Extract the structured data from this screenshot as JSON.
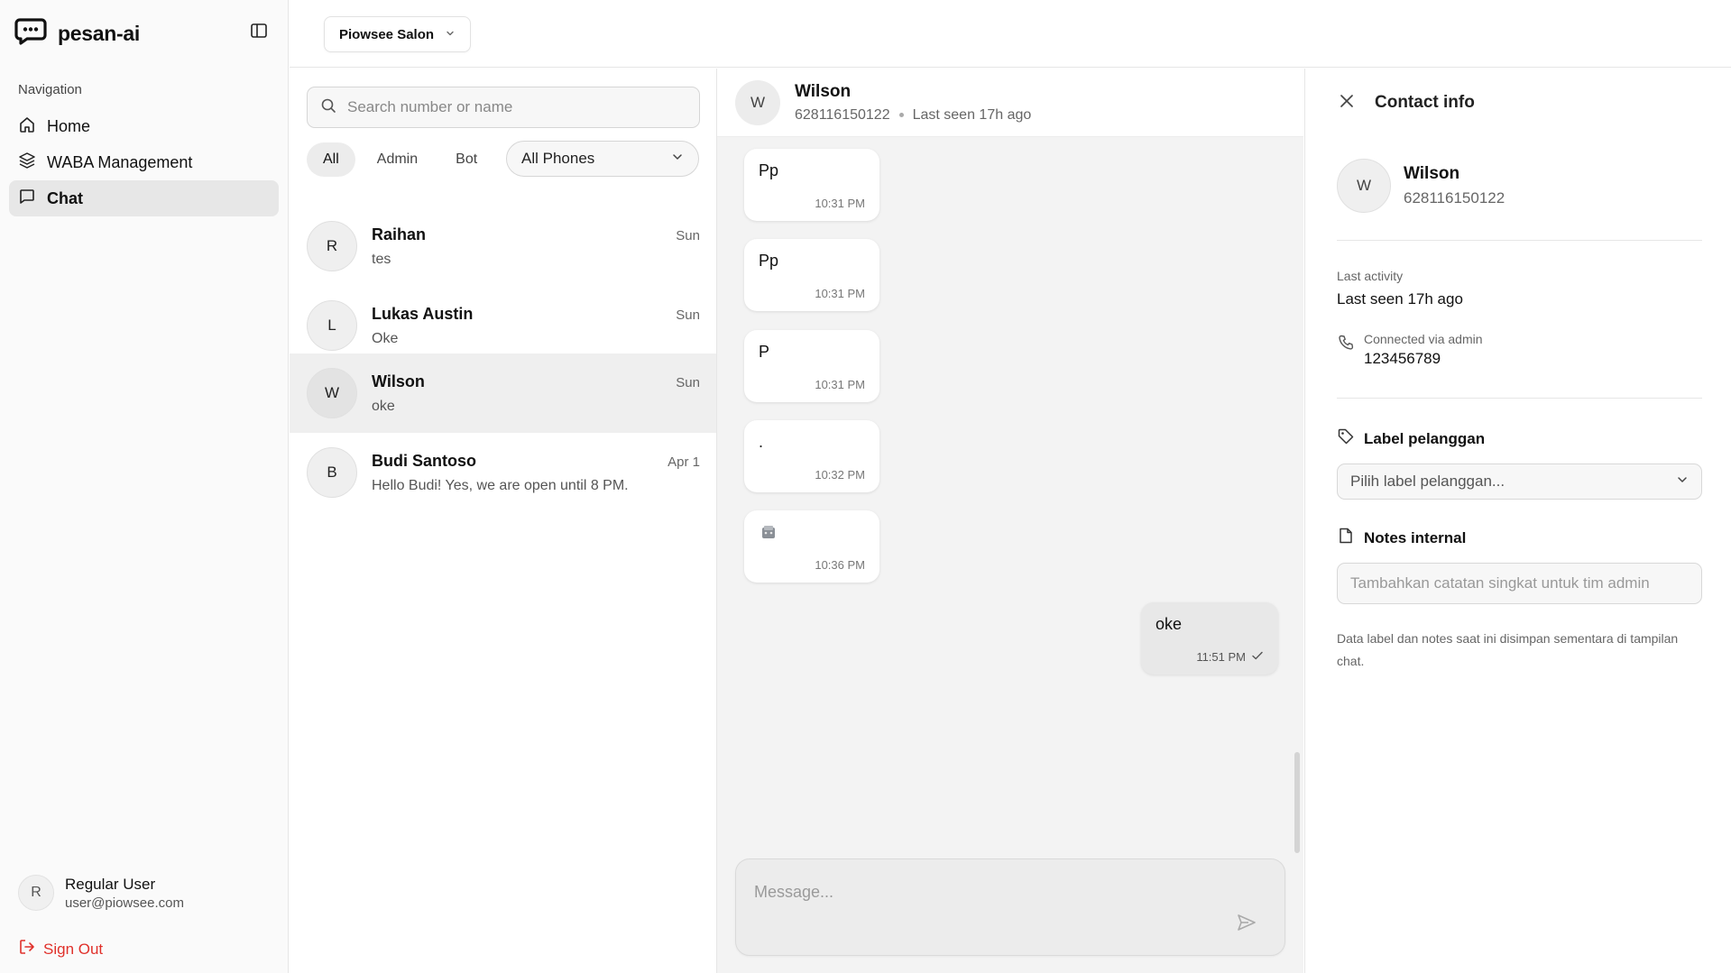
{
  "app": {
    "name": "pesan-ai"
  },
  "sidebar": {
    "nav_heading": "Navigation",
    "items": [
      {
        "label": "Home",
        "icon": "home-icon"
      },
      {
        "label": "WABA Management",
        "icon": "layers-icon"
      },
      {
        "label": "Chat",
        "icon": "message-square-icon",
        "active": true
      }
    ],
    "user": {
      "initial": "R",
      "name": "Regular User",
      "email": "user@piowsee.com"
    },
    "sign_out": "Sign Out"
  },
  "topbar": {
    "workspace": "Piowsee Salon"
  },
  "list": {
    "search_placeholder": "Search number or name",
    "filters": [
      "All",
      "Admin",
      "Bot"
    ],
    "active_filter": "All",
    "phone_filter": "All Phones",
    "conversations": [
      {
        "initial": "R",
        "name": "Raihan",
        "time": "Sun",
        "preview": "tes"
      },
      {
        "initial": "L",
        "name": "Lukas Austin",
        "time": "Sun",
        "preview": "Oke"
      },
      {
        "initial": "W",
        "name": "Wilson",
        "time": "Sun",
        "preview": "oke",
        "active": true
      },
      {
        "initial": "B",
        "name": "Budi Santoso",
        "time": "Apr 1",
        "preview": "Hello Budi! Yes, we are open until 8 PM."
      }
    ]
  },
  "chat": {
    "initial": "W",
    "name": "Wilson",
    "phone": "628116150122",
    "status": "Last seen 17h ago",
    "messages": [
      {
        "direction": "in",
        "text": "Pp",
        "time": "10:31 PM"
      },
      {
        "direction": "in",
        "text": "Pp",
        "time": "10:31 PM"
      },
      {
        "direction": "in",
        "text": "P",
        "time": "10:31 PM"
      },
      {
        "direction": "in",
        "text": ".",
        "time": "10:32 PM"
      },
      {
        "direction": "in",
        "text": "",
        "time": "10:36 PM",
        "attachment": "sticker-icon"
      },
      {
        "direction": "out",
        "text": "oke",
        "time": "11:51 PM",
        "status": "sent"
      }
    ],
    "composer_placeholder": "Message..."
  },
  "contact_info": {
    "title": "Contact info",
    "initial": "W",
    "name": "Wilson",
    "phone": "628116150122",
    "last_activity_label": "Last activity",
    "last_activity_value": "Last seen 17h ago",
    "connected_label": "Connected via admin",
    "connected_value": "123456789",
    "label_section": "Label pelanggan",
    "label_placeholder": "Pilih label pelanggan...",
    "notes_section": "Notes internal",
    "notes_placeholder": "Tambahkan catatan singkat untuk tim admin",
    "footnote": "Data label dan notes saat ini disimpan sementara di tampilan chat."
  },
  "colors": {
    "accent_danger": "#e0302a",
    "active_bg": "#e7e7e7",
    "chat_bg": "#f3f3f3"
  }
}
